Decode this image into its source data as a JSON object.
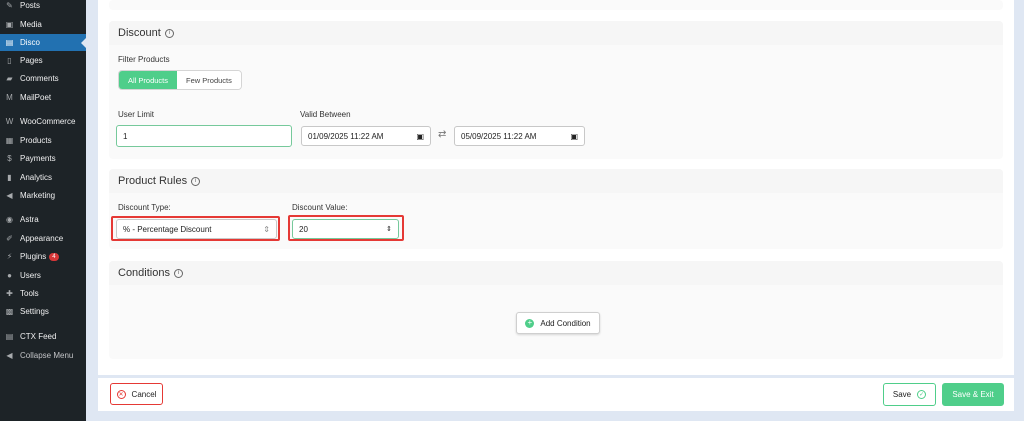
{
  "sidebar": {
    "items": [
      {
        "label": "Posts",
        "icon": "pin-icon"
      },
      {
        "label": "Media",
        "icon": "media-icon"
      },
      {
        "label": "Disco",
        "icon": "disco-icon",
        "active": true
      },
      {
        "label": "Pages",
        "icon": "pages-icon"
      },
      {
        "label": "Comments",
        "icon": "comments-icon"
      },
      {
        "label": "MailPoet",
        "icon": "mailpoet-icon"
      },
      {
        "label": "WooCommerce",
        "icon": "woocommerce-icon"
      },
      {
        "label": "Products",
        "icon": "products-icon"
      },
      {
        "label": "Payments",
        "icon": "payments-icon"
      },
      {
        "label": "Analytics",
        "icon": "analytics-icon"
      },
      {
        "label": "Marketing",
        "icon": "marketing-icon"
      },
      {
        "label": "Astra",
        "icon": "astra-icon"
      },
      {
        "label": "Appearance",
        "icon": "appearance-icon"
      },
      {
        "label": "Plugins",
        "icon": "plugins-icon",
        "badge": "4"
      },
      {
        "label": "Users",
        "icon": "users-icon"
      },
      {
        "label": "Tools",
        "icon": "tools-icon"
      },
      {
        "label": "Settings",
        "icon": "settings-icon"
      },
      {
        "label": "CTX Feed",
        "icon": "ctx-feed-icon"
      },
      {
        "label": "Collapse Menu",
        "icon": "collapse-icon"
      }
    ]
  },
  "discount": {
    "title": "Discount",
    "filter_label": "Filter Products",
    "filter_options": [
      "All Products",
      "Few Products"
    ],
    "user_limit_label": "User Limit",
    "user_limit_value": "1",
    "valid_between_label": "Valid Between",
    "valid_from": "01/09/2025 11:22 AM",
    "valid_to": "05/09/2025 11:22 AM"
  },
  "product_rules": {
    "title": "Product Rules",
    "type_label": "Discount Type:",
    "type_value": "% - Percentage Discount",
    "value_label": "Discount Value:",
    "value_value": "20"
  },
  "conditions": {
    "title": "Conditions",
    "add_label": "Add Condition"
  },
  "footer": {
    "cancel_label": "Cancel",
    "save_label": "Save",
    "save_exit_label": "Save & Exit"
  },
  "colors": {
    "accent": "#4fce8a",
    "danger": "#e53935",
    "wp_blue": "#2271b1",
    "sidebar_bg": "#1d2327"
  }
}
